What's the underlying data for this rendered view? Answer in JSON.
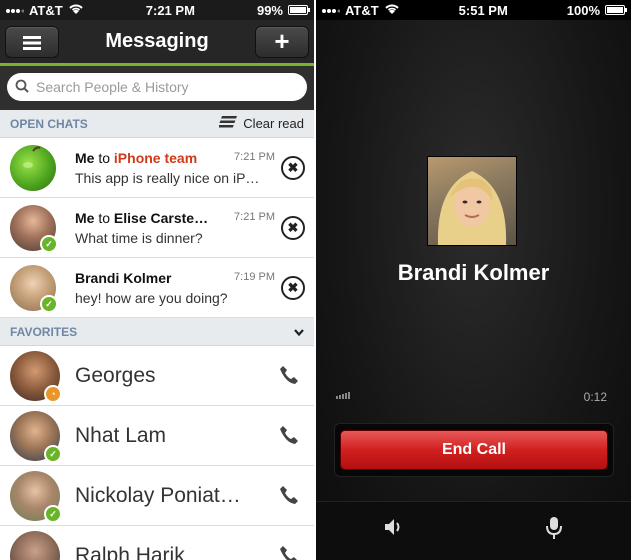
{
  "left_screen": {
    "status": {
      "carrier": "AT&T",
      "time": "7:21 PM",
      "battery": "99%",
      "battery_level": 0.99
    },
    "nav": {
      "title": "Messaging",
      "menu_icon": "menu-icon",
      "add_label": "+"
    },
    "search": {
      "placeholder": "Search People & History"
    },
    "open_chats": {
      "header": "OPEN CHATS",
      "clear_label": "Clear read",
      "items": [
        {
          "sender": "Me",
          "connector": "to",
          "recipient": "iPhone team",
          "recipient_color": "#d0391a",
          "time": "7:21 PM",
          "message": "This app is really nice on iP…",
          "close": "✖"
        },
        {
          "sender": "Me",
          "connector": "to",
          "recipient": "Elise Carste…",
          "recipient_color": "#111111",
          "time": "7:21 PM",
          "message": "What time is dinner?",
          "close": "✖"
        },
        {
          "sender": "Brandi Kolmer",
          "connector": "",
          "recipient": "",
          "recipient_color": "#111111",
          "time": "7:19 PM",
          "message": "hey! how are you doing?",
          "close": "✖"
        }
      ]
    },
    "favorites": {
      "header": "FAVORITES",
      "items": [
        {
          "name": "Georges",
          "status_color": "#e8962a"
        },
        {
          "name": "Nhat Lam",
          "status_color": "#6ab42a"
        },
        {
          "name": "Nickolay Poniat…",
          "status_color": "#6ab42a"
        },
        {
          "name": "Ralph Harik",
          "status_color": "#6ab42a"
        }
      ]
    },
    "colors": {
      "accent_green": "#75b52a",
      "section_text": "#6e87a4"
    }
  },
  "right_screen": {
    "status": {
      "carrier": "AT&T",
      "time": "5:51 PM",
      "battery": "100%",
      "battery_level": 1.0
    },
    "caller_name": "Brandi Kolmer",
    "duration": "0:12",
    "end_call_label": "End Call",
    "end_call_color": "#d11f1f",
    "controls": [
      "speaker-icon",
      "microphone-icon"
    ]
  }
}
